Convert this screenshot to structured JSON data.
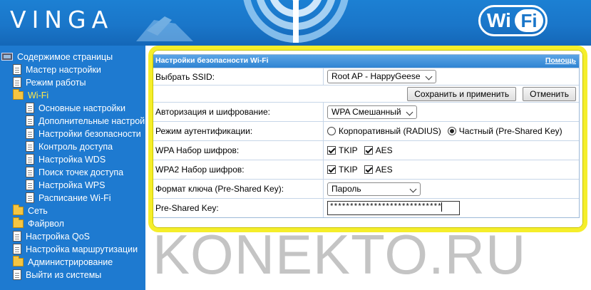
{
  "header": {
    "logo": "VINGA",
    "wifi_badge_wi": "Wi",
    "wifi_badge_fi": "Fi"
  },
  "sidebar": {
    "root": "Содержимое страницы",
    "items": [
      {
        "label": "Мастер настройки",
        "icon": "document-icon"
      },
      {
        "label": "Режим работы",
        "icon": "document-icon"
      },
      {
        "label": "Wi-Fi",
        "icon": "folder-icon",
        "active": true
      },
      {
        "label": "Основные настройки",
        "icon": "document-icon"
      },
      {
        "label": "Дополнительные настрой",
        "icon": "document-icon"
      },
      {
        "label": "Настройки безопасности",
        "icon": "document-icon"
      },
      {
        "label": "Контроль доступа",
        "icon": "document-icon"
      },
      {
        "label": "Настройка WDS",
        "icon": "document-icon"
      },
      {
        "label": "Поиск точек доступа",
        "icon": "document-icon"
      },
      {
        "label": "Настройка WPS",
        "icon": "document-icon"
      },
      {
        "label": "Расписание Wi-Fi",
        "icon": "document-icon"
      },
      {
        "label": "Сеть",
        "icon": "folder-icon"
      },
      {
        "label": "Файрвол",
        "icon": "folder-icon"
      },
      {
        "label": "Настройка QoS",
        "icon": "document-icon"
      },
      {
        "label": "Настройка маршрутизации",
        "icon": "document-icon"
      },
      {
        "label": "Администрирование",
        "icon": "folder-icon"
      },
      {
        "label": "Выйти из системы",
        "icon": "document-icon"
      }
    ]
  },
  "panel": {
    "title": "Настройки безопасности Wi-Fi",
    "help": "Помощь",
    "ssid_label": "Выбрать SSID:",
    "ssid_value": "Root AP - HappyGeese",
    "save_button": "Сохранить и применить",
    "cancel_button": "Отменить",
    "auth_label": "Авторизация и шифрование:",
    "auth_value": "WPA Смешанный",
    "mode_label": "Режим аутентификации:",
    "mode_option1": "Корпоративный (RADIUS)",
    "mode_option2": "Частный (Pre-Shared Key)",
    "mode_selected": 2,
    "wpa_label": "WPA Набор шифров:",
    "wpa_tkip": "TKIP",
    "wpa_aes": "AES",
    "wpa2_label": "WPA2 Набор шифров:",
    "wpa2_tkip": "TKIP",
    "wpa2_aes": "AES",
    "key_format_label": "Формат ключа (Pre-Shared Key):",
    "key_format_value": "Пароль",
    "psk_label": "Pre-Shared Key:",
    "psk_value": "****************************"
  },
  "watermark": "KONEKTO.RU",
  "colors": {
    "header_blue": "#1a76c9",
    "sidebar_blue": "#1e7ad0",
    "highlight_yellow": "#f5ee2a",
    "active_item": "#ffe94a"
  }
}
